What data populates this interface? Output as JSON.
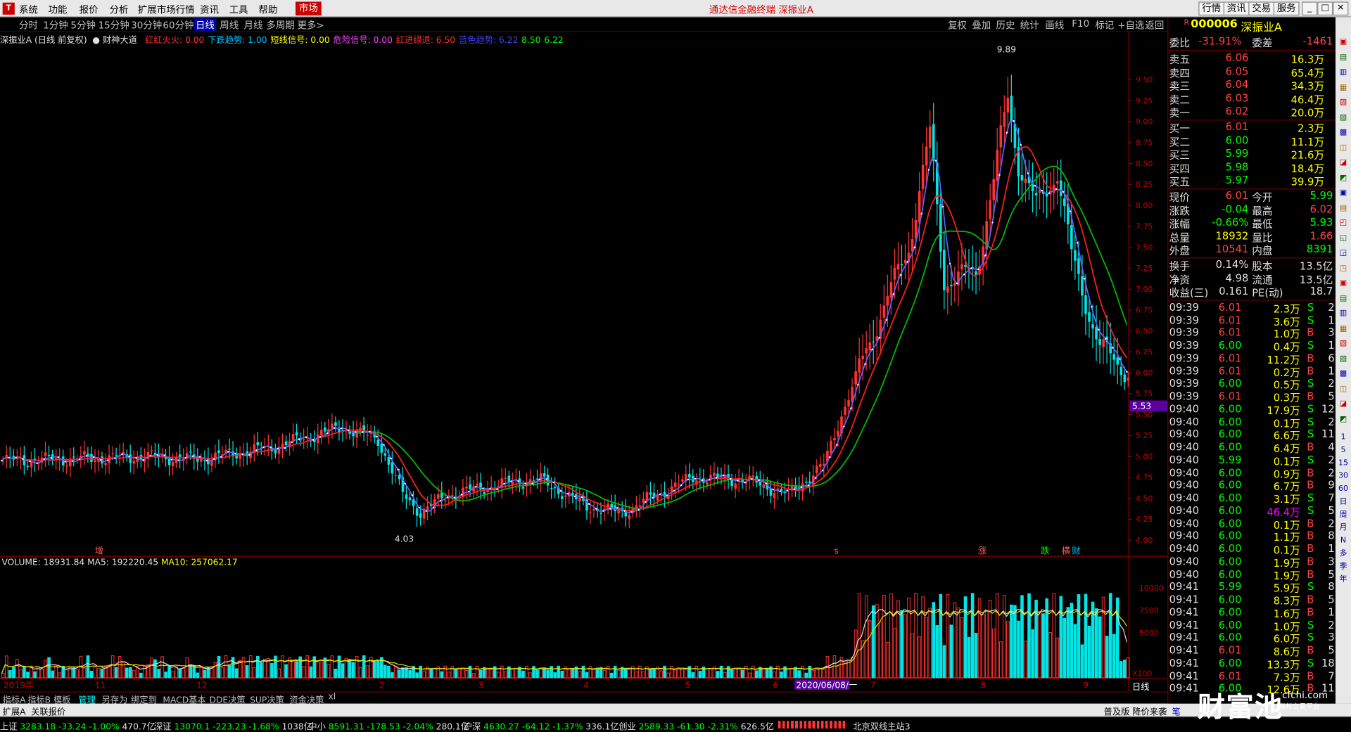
{
  "menu": {
    "items": [
      "系统",
      "功能",
      "报价",
      "分析",
      "扩展市场行情",
      "资讯",
      "工具",
      "帮助"
    ],
    "market_tab": "市场",
    "center_title": "通达信金融终端  深振业A",
    "right_buttons": [
      "行情",
      "资讯",
      "交易",
      "服务"
    ],
    "logo": "T"
  },
  "periods": [
    "分时",
    "1分钟",
    "5分钟",
    "15分钟",
    "30分钟",
    "60分钟",
    "日线",
    "周线",
    "月线",
    "多周期",
    "更多>"
  ],
  "active_period": "日线",
  "tools": [
    "复权",
    "叠加",
    "历史",
    "统计",
    "画线",
    "F10",
    "标记",
    "+自选",
    "返回"
  ],
  "legend": {
    "stock": "深振业A (日线 前复权)",
    "indicator": "财神大道",
    "items": [
      {
        "label": "红红火火:",
        "value": "0.00",
        "color": "#ff3030"
      },
      {
        "label": "下跌趋势:",
        "value": "1.00",
        "color": "#00c0ff"
      },
      {
        "label": "短线信号:",
        "value": "0.00",
        "color": "#ffff00"
      },
      {
        "label": "危险信号:",
        "value": "0.00",
        "color": "#ff40ff"
      },
      {
        "label": "红进绿退:",
        "value": "6.50",
        "color": "#ff3030"
      },
      {
        "label": "蓝色趋势:",
        "value": "6.22",
        "color": "#4040ff"
      },
      {
        "label": "",
        "value": "8.50",
        "color": "#00ff00"
      },
      {
        "label": "",
        "value": "6.22",
        "color": "#00ff00"
      }
    ]
  },
  "chart_data": {
    "type": "candlestick",
    "title": "深振业A (日线 前复权)",
    "ylim": [
      3.9,
      9.95
    ],
    "yticks": [
      "9.50",
      "9.25",
      "9.00",
      "8.75",
      "8.50",
      "8.25",
      "8.00",
      "7.75",
      "7.50",
      "7.25",
      "7.00",
      "6.75",
      "6.50",
      "6.25",
      "6.00",
      "5.75",
      "5.50",
      "5.25",
      "5.00",
      "4.75",
      "4.50",
      "4.25",
      "4.00"
    ],
    "x_labels": [
      "2019年",
      "11",
      "12",
      "2",
      "3",
      "4",
      "5",
      "6",
      "2020/06/08/一",
      "7",
      "8",
      "9"
    ],
    "annotations": [
      {
        "text": "9.89",
        "kind": "max"
      },
      {
        "text": "4.03",
        "kind": "min"
      },
      {
        "text": "5.53",
        "kind": "cursor"
      }
    ],
    "signals": [
      {
        "text": "增",
        "color": "#ff6060"
      },
      {
        "text": "s",
        "color": "#ff6060"
      },
      {
        "text": "涨",
        "color": "#ff6060"
      },
      {
        "text": "跌",
        "color": "#00ff00"
      },
      {
        "text": "横",
        "color": "#ff6060"
      },
      {
        "text": "财",
        "color": "#00c0ff"
      }
    ],
    "anchors": [
      {
        "i": 0,
        "c": 4.95
      },
      {
        "i": 20,
        "c": 4.97
      },
      {
        "i": 40,
        "c": 5.0
      },
      {
        "i": 55,
        "c": 4.97
      },
      {
        "i": 75,
        "c": 5.1
      },
      {
        "i": 96,
        "c": 5.35
      },
      {
        "i": 106,
        "c": 5.2
      },
      {
        "i": 113,
        "c": 4.55
      },
      {
        "i": 118,
        "c": 4.33
      },
      {
        "i": 126,
        "c": 4.55
      },
      {
        "i": 145,
        "c": 4.7
      },
      {
        "i": 152,
        "c": 4.72
      },
      {
        "i": 165,
        "c": 4.4
      },
      {
        "i": 175,
        "c": 4.33
      },
      {
        "i": 185,
        "c": 4.55
      },
      {
        "i": 195,
        "c": 4.75
      },
      {
        "i": 210,
        "c": 4.72
      },
      {
        "i": 222,
        "c": 4.55
      },
      {
        "i": 232,
        "c": 4.9
      },
      {
        "i": 237,
        "c": 5.5
      },
      {
        "i": 248,
        "c": 6.7
      },
      {
        "i": 256,
        "c": 7.5
      },
      {
        "i": 262,
        "c": 8.85
      },
      {
        "i": 266,
        "c": 7.1
      },
      {
        "i": 275,
        "c": 7.2
      },
      {
        "i": 280,
        "c": 8.3
      },
      {
        "i": 284,
        "c": 9.3
      },
      {
        "i": 287,
        "c": 8.5
      },
      {
        "i": 292,
        "c": 8.0
      },
      {
        "i": 298,
        "c": 8.4
      },
      {
        "i": 302,
        "c": 7.4
      },
      {
        "i": 310,
        "c": 6.3
      },
      {
        "i": 318,
        "c": 6.01
      }
    ],
    "candle_count": 319,
    "volume": {
      "legend": "VOLUME: 18931.84",
      "ma5": "MA5: 192220.45",
      "ma10": "MA10: 257062.17",
      "yticks": [
        "10000",
        "7500",
        "5000"
      ],
      "unit": "X100"
    }
  },
  "orderbook": {
    "code": "000006",
    "name": "深振业A",
    "weibi": {
      "label": "委比",
      "value": "-31.91%"
    },
    "weicha": {
      "label": "委差",
      "value": "-1461"
    },
    "asks": [
      {
        "label": "卖五",
        "price": "6.06",
        "vol": "16.3万"
      },
      {
        "label": "卖四",
        "price": "6.05",
        "vol": "65.4万"
      },
      {
        "label": "卖三",
        "price": "6.04",
        "vol": "34.3万"
      },
      {
        "label": "卖二",
        "price": "6.03",
        "vol": "46.4万"
      },
      {
        "label": "卖一",
        "price": "6.02",
        "vol": "20.0万"
      }
    ],
    "bids": [
      {
        "label": "买一",
        "price": "6.01",
        "vol": "2.3万"
      },
      {
        "label": "买二",
        "price": "6.00",
        "vol": "11.1万"
      },
      {
        "label": "买三",
        "price": "5.99",
        "vol": "21.6万"
      },
      {
        "label": "买四",
        "price": "5.98",
        "vol": "18.4万"
      },
      {
        "label": "买五",
        "price": "5.97",
        "vol": "39.9万"
      }
    ],
    "stats": [
      {
        "l1": "现价",
        "v1": "6.01",
        "l2": "今开",
        "v2": "5.99",
        "c1": "r",
        "c2": "g"
      },
      {
        "l1": "涨跌",
        "v1": "-0.04",
        "l2": "最高",
        "v2": "6.02",
        "c1": "g",
        "c2": "r"
      },
      {
        "l1": "涨幅",
        "v1": "-0.66%",
        "l2": "最低",
        "v2": "5.93",
        "c1": "g",
        "c2": "g"
      },
      {
        "l1": "总量",
        "v1": "18932",
        "l2": "量比",
        "v2": "1.66",
        "c1": "y",
        "c2": "r"
      },
      {
        "l1": "外盘",
        "v1": "10541",
        "l2": "内盘",
        "v2": "8391",
        "c1": "r",
        "c2": "g"
      }
    ],
    "stats2": [
      {
        "l1": "换手",
        "v1": "0.14%",
        "l2": "股本",
        "v2": "13.5亿"
      },
      {
        "l1": "净资",
        "v1": "4.98",
        "l2": "流通",
        "v2": "13.5亿"
      },
      {
        "l1": "收益(三)",
        "v1": "0.161",
        "l2": "PE(动)",
        "v2": "18.7"
      }
    ]
  },
  "ticks": [
    [
      "09:39",
      "6.01",
      "2.3万",
      "S",
      "2"
    ],
    [
      "09:39",
      "6.01",
      "3.6万",
      "S",
      "1"
    ],
    [
      "09:39",
      "6.01",
      "1.0万",
      "B",
      "3"
    ],
    [
      "09:39",
      "6.00",
      "0.4万",
      "S",
      "1"
    ],
    [
      "09:39",
      "6.01",
      "11.2万",
      "B",
      "6"
    ],
    [
      "09:39",
      "6.01",
      "0.2万",
      "B",
      "1"
    ],
    [
      "09:39",
      "6.00",
      "0.5万",
      "S",
      "2"
    ],
    [
      "09:39",
      "6.01",
      "0.3万",
      "B",
      "5"
    ],
    [
      "09:40",
      "6.00",
      "17.9万",
      "S",
      "12"
    ],
    [
      "09:40",
      "6.00",
      "0.1万",
      "S",
      "2"
    ],
    [
      "09:40",
      "6.00",
      "6.6万",
      "S",
      "11"
    ],
    [
      "09:40",
      "6.00",
      "6.4万",
      "B",
      "4"
    ],
    [
      "09:40",
      "5.99",
      "0.1万",
      "S",
      "2"
    ],
    [
      "09:40",
      "6.00",
      "0.9万",
      "B",
      "2"
    ],
    [
      "09:40",
      "6.00",
      "6.7万",
      "B",
      "9"
    ],
    [
      "09:40",
      "6.00",
      "3.1万",
      "S",
      "7"
    ],
    [
      "09:40",
      "6.00",
      "46.4万",
      "S",
      "5"
    ],
    [
      "09:40",
      "6.00",
      "0.1万",
      "B",
      "2"
    ],
    [
      "09:40",
      "6.00",
      "1.1万",
      "B",
      "8"
    ],
    [
      "09:40",
      "6.00",
      "0.1万",
      "B",
      "1"
    ],
    [
      "09:40",
      "6.00",
      "1.9万",
      "B",
      "3"
    ],
    [
      "09:40",
      "6.00",
      "1.9万",
      "B",
      "5"
    ],
    [
      "09:41",
      "5.99",
      "5.9万",
      "S",
      "8"
    ],
    [
      "09:41",
      "6.00",
      "8.3万",
      "B",
      "5"
    ],
    [
      "09:41",
      "6.00",
      "1.6万",
      "B",
      "1"
    ],
    [
      "09:41",
      "6.00",
      "1.0万",
      "S",
      "2"
    ],
    [
      "09:41",
      "6.00",
      "6.0万",
      "S",
      "3"
    ],
    [
      "09:41",
      "6.01",
      "8.6万",
      "B",
      "5"
    ],
    [
      "09:41",
      "6.00",
      "13.3万",
      "S",
      "18"
    ],
    [
      "09:41",
      "6.01",
      "7.3万",
      "B",
      "7"
    ],
    [
      "09:41",
      "6.00",
      "12.6万",
      "B",
      "11"
    ],
    [
      "09:41",
      "",
      "",
      "",
      ""
    ]
  ],
  "bottom_tabs": [
    "指标A",
    "指标B",
    "模板",
    "管理",
    "另存为",
    "绑定到",
    "MACD基本",
    "DDE决策",
    "SUP决策",
    "资金决策",
    "xl"
  ],
  "bottom_tabs_active": "管理",
  "bottom_row2": {
    "left": "扩展A",
    "left2": "关联报价",
    "right": "普及版 降价来袭",
    "right_tab": "笔",
    "period_label": "日线"
  },
  "status": [
    {
      "name": "上证",
      "val": "3283.18",
      "chg": "-33.24",
      "pct": "-1.00%",
      "amt": "470.7亿"
    },
    {
      "name": "深证",
      "val": "13070.1",
      "chg": "-223.23",
      "pct": "-1.68%",
      "amt": "1038亿"
    },
    {
      "name": "中小",
      "val": "8591.31",
      "chg": "-178.53",
      "pct": "-2.04%",
      "amt": "280.1亿"
    },
    {
      "name": "沪深",
      "val": "4630.27",
      "chg": "-64.12",
      "pct": "-1.37%",
      "amt": "336.1亿"
    },
    {
      "name": "创业",
      "val": "2589.33",
      "chg": "-61.30",
      "pct": "-2.31%",
      "amt": "626.5亿"
    }
  ],
  "server": "北京双线主站3",
  "watermark": {
    "main": "财富池",
    "site": "cfchi.com",
    "sub": "指标交易平台"
  },
  "side_icons": [
    "1",
    "5",
    "15",
    "30",
    "60",
    "日",
    "周",
    "月",
    "N",
    "多",
    "季",
    "年"
  ]
}
